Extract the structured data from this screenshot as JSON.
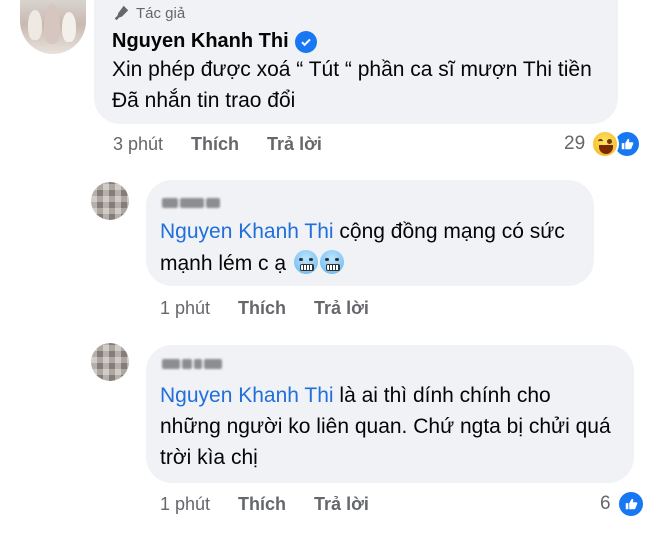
{
  "post_author_comment": {
    "author_tag": "Tác giả",
    "author_name": "Nguyen Khanh Thi",
    "line1": "Xin phép được xoá “ Tút “ phần ca sĩ mượn Thi tiền",
    "line2": "Đã nhắn tin trao đổi",
    "time": "3 phút",
    "like_label": "Thích",
    "reply_label": "Trả lời",
    "reaction_count": "29",
    "reactions": [
      "haha-icon",
      "like-icon"
    ]
  },
  "reply1": {
    "mention": "Nguyen Khanh Thi",
    "line1_rest": " cộng đồng mạng có sức",
    "line2": "mạnh lém c ạ",
    "emojis": [
      "grimacing-face-icon",
      "grimacing-face-icon"
    ],
    "time": "1 phút",
    "like_label": "Thích",
    "reply_label": "Trả lời"
  },
  "reply2": {
    "mention": "Nguyen Khanh Thi",
    "line1_rest": " là ai thì dính chính cho",
    "line2": "những người ko liên quan. Chứ ngta bị chửi quá",
    "line3": "trời kìa chị",
    "time": "1 phút",
    "like_label": "Thích",
    "reply_label": "Trả lời",
    "reaction_count": "6",
    "reactions": [
      "like-icon"
    ]
  },
  "colors": {
    "bubble": "#f0f2f5",
    "mention": "#216fdb",
    "secondary_text": "#65676b",
    "like_blue": "#1877f2"
  }
}
